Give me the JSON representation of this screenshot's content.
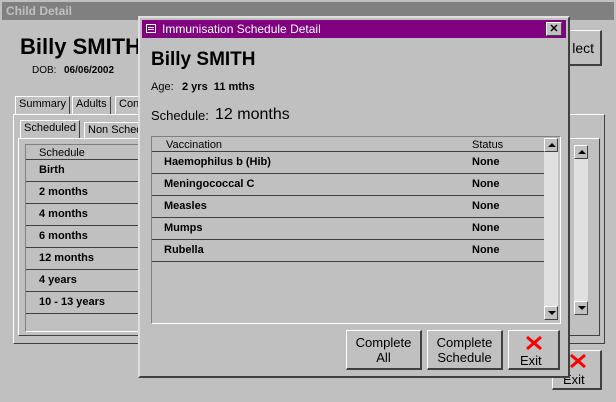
{
  "background_window": {
    "title": "Child Detail",
    "child_name": "Billy SMITH",
    "dob_label": "DOB:",
    "dob_value": "06/06/2002",
    "tabs": [
      "Summary",
      "Adults",
      "Con"
    ],
    "subtabs": [
      "Scheduled",
      "Non Sched"
    ],
    "list_header": "Schedule",
    "schedule_items": [
      "Birth",
      "2 months",
      "4 months",
      "6 months",
      "12 months",
      "4 years",
      "10 - 13 years"
    ],
    "select_button_label": "lect",
    "exit_button_label": "Exit"
  },
  "dialog": {
    "title": "Immunisation Schedule Detail",
    "child_name": "Billy SMITH",
    "age_label": "Age:",
    "age_value": "2 yrs  11 mths",
    "schedule_label": "Schedule:",
    "schedule_value": "12 months",
    "columns": [
      "Vaccination",
      "Status"
    ],
    "rows": [
      {
        "vaccination": "Haemophilus b (Hib)",
        "status": "None"
      },
      {
        "vaccination": "Meningococcal C",
        "status": "None"
      },
      {
        "vaccination": "Measles",
        "status": "None"
      },
      {
        "vaccination": "Mumps",
        "status": "None"
      },
      {
        "vaccination": "Rubella",
        "status": "None"
      }
    ],
    "buttons": {
      "complete_all_line1": "Complete",
      "complete_all_line2": "All",
      "complete_schedule_line1": "Complete",
      "complete_schedule_line2": "Schedule",
      "exit": "Exit"
    },
    "close_glyph": "✕"
  },
  "colors": {
    "dialog_titlebar": "#800080",
    "background_titlebar": "#808080",
    "exit_icon": "#ff0000"
  }
}
